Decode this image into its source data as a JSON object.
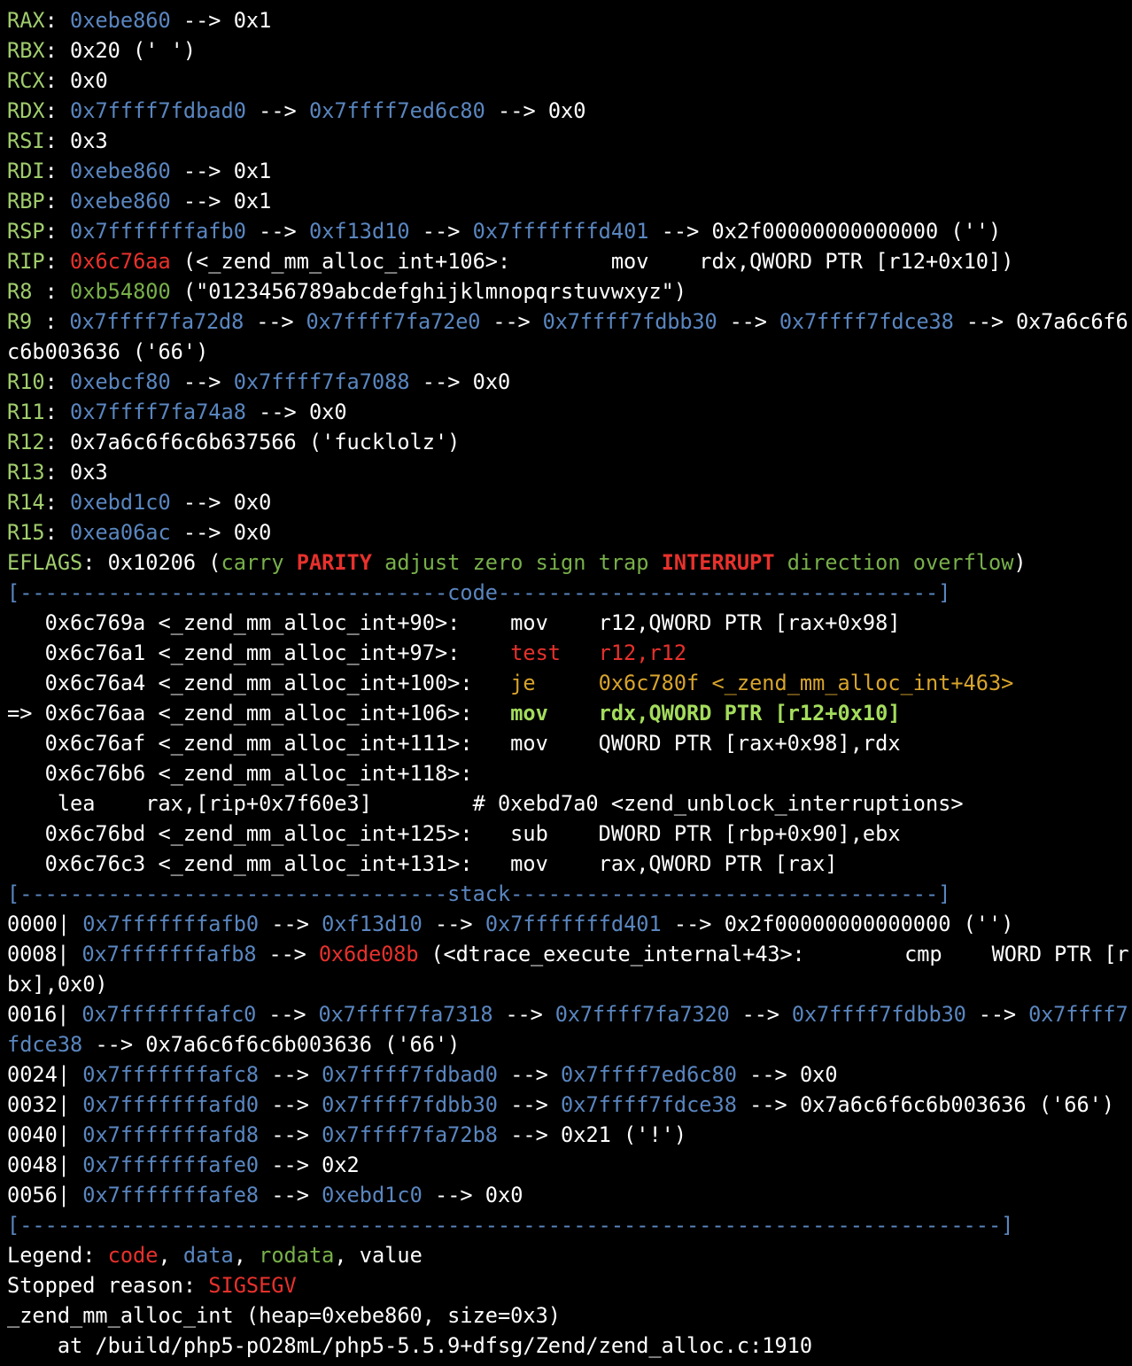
{
  "colors": {
    "value": "#ffffff",
    "code": "#e8312c",
    "data": "#5a86c0",
    "rodata": "#78b04a",
    "label": "#a0cc6c",
    "jump": "#d8a42c",
    "current": "#a4dc5c",
    "separator": "#5a86c0",
    "background": "#000000"
  },
  "terminal": {
    "lines": [
      [
        {
          "t": "RAX",
          "c": "label"
        },
        {
          "t": ": ",
          "c": "value"
        },
        {
          "t": "0xebe860",
          "c": "data"
        },
        {
          "t": " --> 0x1",
          "c": "value"
        }
      ],
      [
        {
          "t": "RBX",
          "c": "label"
        },
        {
          "t": ": 0x20 (' ')",
          "c": "value"
        }
      ],
      [
        {
          "t": "RCX",
          "c": "label"
        },
        {
          "t": ": 0x0",
          "c": "value"
        }
      ],
      [
        {
          "t": "RDX",
          "c": "label"
        },
        {
          "t": ": ",
          "c": "value"
        },
        {
          "t": "0x7ffff7fdbad0",
          "c": "data"
        },
        {
          "t": " --> ",
          "c": "value"
        },
        {
          "t": "0x7ffff7ed6c80",
          "c": "data"
        },
        {
          "t": " --> 0x0",
          "c": "value"
        }
      ],
      [
        {
          "t": "RSI",
          "c": "label"
        },
        {
          "t": ": 0x3",
          "c": "value"
        }
      ],
      [
        {
          "t": "RDI",
          "c": "label"
        },
        {
          "t": ": ",
          "c": "value"
        },
        {
          "t": "0xebe860",
          "c": "data"
        },
        {
          "t": " --> 0x1",
          "c": "value"
        }
      ],
      [
        {
          "t": "RBP",
          "c": "label"
        },
        {
          "t": ": ",
          "c": "value"
        },
        {
          "t": "0xebe860",
          "c": "data"
        },
        {
          "t": " --> 0x1",
          "c": "value"
        }
      ],
      [
        {
          "t": "RSP",
          "c": "label"
        },
        {
          "t": ": ",
          "c": "value"
        },
        {
          "t": "0x7fffffffafb0",
          "c": "data"
        },
        {
          "t": " --> ",
          "c": "value"
        },
        {
          "t": "0xf13d10",
          "c": "data"
        },
        {
          "t": " --> ",
          "c": "value"
        },
        {
          "t": "0x7fffffffd401",
          "c": "data"
        },
        {
          "t": " --> 0x2f00000000000000 ('')",
          "c": "value"
        }
      ],
      [
        {
          "t": "RIP",
          "c": "label"
        },
        {
          "t": ": ",
          "c": "value"
        },
        {
          "t": "0x6c76aa",
          "c": "code"
        },
        {
          "t": " (<_zend_mm_alloc_int+106>:        mov    rdx,QWORD PTR [r12+0x10])",
          "c": "value"
        }
      ],
      [
        {
          "t": "R8 ",
          "c": "label"
        },
        {
          "t": ": ",
          "c": "value"
        },
        {
          "t": "0xb54800",
          "c": "rodata"
        },
        {
          "t": " (\"0123456789abcdefghijklmnopqrstuvwxyz\")",
          "c": "value"
        }
      ],
      [
        {
          "t": "R9 ",
          "c": "label"
        },
        {
          "t": ": ",
          "c": "value"
        },
        {
          "t": "0x7ffff7fa72d8",
          "c": "data"
        },
        {
          "t": " --> ",
          "c": "value"
        },
        {
          "t": "0x7ffff7fa72e0",
          "c": "data"
        },
        {
          "t": " --> ",
          "c": "value"
        },
        {
          "t": "0x7ffff7fdbb30",
          "c": "data"
        },
        {
          "t": " --> ",
          "c": "value"
        },
        {
          "t": "0x7ffff7fdce38",
          "c": "data"
        },
        {
          "t": " --> 0x7a6c6f6",
          "c": "value"
        }
      ],
      [
        {
          "t": "c6b003636 ('66')",
          "c": "value"
        }
      ],
      [
        {
          "t": "R10",
          "c": "label"
        },
        {
          "t": ": ",
          "c": "value"
        },
        {
          "t": "0xebcf80",
          "c": "data"
        },
        {
          "t": " --> ",
          "c": "value"
        },
        {
          "t": "0x7ffff7fa7088",
          "c": "data"
        },
        {
          "t": " --> 0x0",
          "c": "value"
        }
      ],
      [
        {
          "t": "R11",
          "c": "label"
        },
        {
          "t": ": ",
          "c": "value"
        },
        {
          "t": "0x7ffff7fa74a8",
          "c": "data"
        },
        {
          "t": " --> 0x0",
          "c": "value"
        }
      ],
      [
        {
          "t": "R12",
          "c": "label"
        },
        {
          "t": ": 0x7a6c6f6c6b637566 ('fucklolz')",
          "c": "value"
        }
      ],
      [
        {
          "t": "R13",
          "c": "label"
        },
        {
          "t": ": 0x3",
          "c": "value"
        }
      ],
      [
        {
          "t": "R14",
          "c": "label"
        },
        {
          "t": ": ",
          "c": "value"
        },
        {
          "t": "0xebd1c0",
          "c": "data"
        },
        {
          "t": " --> 0x0",
          "c": "value"
        }
      ],
      [
        {
          "t": "R15",
          "c": "label"
        },
        {
          "t": ": ",
          "c": "value"
        },
        {
          "t": "0xea06ac",
          "c": "data"
        },
        {
          "t": " --> 0x0",
          "c": "value"
        }
      ],
      [
        {
          "t": "EFLAGS",
          "c": "label"
        },
        {
          "t": ": 0x10206 (",
          "c": "value"
        },
        {
          "t": "carry ",
          "c": "rodata"
        },
        {
          "t": "PARITY",
          "c": "code",
          "b": true
        },
        {
          "t": " adjust zero sign trap ",
          "c": "rodata"
        },
        {
          "t": "INTERRUPT",
          "c": "code",
          "b": true
        },
        {
          "t": " direction overflow",
          "c": "rodata"
        },
        {
          "t": ")",
          "c": "value"
        }
      ],
      [
        {
          "t": "[----------------------------------code-----------------------------------]",
          "c": "separator"
        }
      ],
      [
        {
          "t": "   0x6c769a <_zend_mm_alloc_int+90>:    mov    r12,QWORD PTR [rax+0x98]",
          "c": "value"
        }
      ],
      [
        {
          "t": "   0x6c76a1 <_zend_mm_alloc_int+97>:    ",
          "c": "value"
        },
        {
          "t": "test   r12,r12",
          "c": "code"
        }
      ],
      [
        {
          "t": "   0x6c76a4 <_zend_mm_alloc_int+100>:   ",
          "c": "value"
        },
        {
          "t": "je     0x6c780f <_zend_mm_alloc_int+463>",
          "c": "jump"
        }
      ],
      [
        {
          "t": "=> 0x6c76aa <_zend_mm_alloc_int+106>:   ",
          "c": "value"
        },
        {
          "t": "mov    rdx,QWORD PTR [r12+0x10]",
          "c": "current",
          "b": true
        }
      ],
      [
        {
          "t": "   0x6c76af <_zend_mm_alloc_int+111>:   mov    QWORD PTR [rax+0x98],rdx",
          "c": "value"
        }
      ],
      [
        {
          "t": "   0x6c76b6 <_zend_mm_alloc_int+118>:",
          "c": "value"
        }
      ],
      [
        {
          "t": "    lea    rax,[rip+0x7f60e3]        # 0xebd7a0 <zend_unblock_interruptions>",
          "c": "value"
        }
      ],
      [
        {
          "t": "   0x6c76bd <_zend_mm_alloc_int+125>:   sub    DWORD PTR [rbp+0x90],ebx",
          "c": "value"
        }
      ],
      [
        {
          "t": "   0x6c76c3 <_zend_mm_alloc_int+131>:   mov    rax,QWORD PTR [rax]",
          "c": "value"
        }
      ],
      [
        {
          "t": "[----------------------------------stack----------------------------------]",
          "c": "separator"
        }
      ],
      [
        {
          "t": "0000| ",
          "c": "value"
        },
        {
          "t": "0x7fffffffafb0",
          "c": "data"
        },
        {
          "t": " --> ",
          "c": "value"
        },
        {
          "t": "0xf13d10",
          "c": "data"
        },
        {
          "t": " --> ",
          "c": "value"
        },
        {
          "t": "0x7fffffffd401",
          "c": "data"
        },
        {
          "t": " --> 0x2f00000000000000 ('')",
          "c": "value"
        }
      ],
      [
        {
          "t": "0008| ",
          "c": "value"
        },
        {
          "t": "0x7fffffffafb8",
          "c": "data"
        },
        {
          "t": " --> ",
          "c": "value"
        },
        {
          "t": "0x6de08b",
          "c": "code"
        },
        {
          "t": " (<dtrace_execute_internal+43>:        cmp    WORD PTR [r",
          "c": "value"
        }
      ],
      [
        {
          "t": "bx],0x0)",
          "c": "value"
        }
      ],
      [
        {
          "t": "0016| ",
          "c": "value"
        },
        {
          "t": "0x7fffffffafc0",
          "c": "data"
        },
        {
          "t": " --> ",
          "c": "value"
        },
        {
          "t": "0x7ffff7fa7318",
          "c": "data"
        },
        {
          "t": " --> ",
          "c": "value"
        },
        {
          "t": "0x7ffff7fa7320",
          "c": "data"
        },
        {
          "t": " --> ",
          "c": "value"
        },
        {
          "t": "0x7ffff7fdbb30",
          "c": "data"
        },
        {
          "t": " --> ",
          "c": "value"
        },
        {
          "t": "0x7ffff7",
          "c": "data"
        }
      ],
      [
        {
          "t": "fdce38",
          "c": "data"
        },
        {
          "t": " --> 0x7a6c6f6c6b003636 ('66')",
          "c": "value"
        }
      ],
      [
        {
          "t": "0024| ",
          "c": "value"
        },
        {
          "t": "0x7fffffffafc8",
          "c": "data"
        },
        {
          "t": " --> ",
          "c": "value"
        },
        {
          "t": "0x7ffff7fdbad0",
          "c": "data"
        },
        {
          "t": " --> ",
          "c": "value"
        },
        {
          "t": "0x7ffff7ed6c80",
          "c": "data"
        },
        {
          "t": " --> 0x0",
          "c": "value"
        }
      ],
      [
        {
          "t": "0032| ",
          "c": "value"
        },
        {
          "t": "0x7fffffffafd0",
          "c": "data"
        },
        {
          "t": " --> ",
          "c": "value"
        },
        {
          "t": "0x7ffff7fdbb30",
          "c": "data"
        },
        {
          "t": " --> ",
          "c": "value"
        },
        {
          "t": "0x7ffff7fdce38",
          "c": "data"
        },
        {
          "t": " --> 0x7a6c6f6c6b003636 ('66')",
          "c": "value"
        }
      ],
      [
        {
          "t": "0040| ",
          "c": "value"
        },
        {
          "t": "0x7fffffffafd8",
          "c": "data"
        },
        {
          "t": " --> ",
          "c": "value"
        },
        {
          "t": "0x7ffff7fa72b8",
          "c": "data"
        },
        {
          "t": " --> 0x21 ('!')",
          "c": "value"
        }
      ],
      [
        {
          "t": "0048| ",
          "c": "value"
        },
        {
          "t": "0x7fffffffafe0",
          "c": "data"
        },
        {
          "t": " --> 0x2",
          "c": "value"
        }
      ],
      [
        {
          "t": "0056| ",
          "c": "value"
        },
        {
          "t": "0x7fffffffafe8",
          "c": "data"
        },
        {
          "t": " --> ",
          "c": "value"
        },
        {
          "t": "0xebd1c0",
          "c": "data"
        },
        {
          "t": " --> 0x0",
          "c": "value"
        }
      ],
      [
        {
          "t": "[------------------------------------------------------------------------------]",
          "c": "separator"
        }
      ],
      [
        {
          "t": "Legend: ",
          "c": "value"
        },
        {
          "t": "code",
          "c": "code"
        },
        {
          "t": ", ",
          "c": "value"
        },
        {
          "t": "data",
          "c": "data"
        },
        {
          "t": ", ",
          "c": "value"
        },
        {
          "t": "rodata",
          "c": "rodata"
        },
        {
          "t": ", value",
          "c": "value"
        }
      ],
      [
        {
          "t": "Stopped reason: ",
          "c": "value"
        },
        {
          "t": "SIGSEGV",
          "c": "code"
        }
      ],
      [
        {
          "t": "_zend_mm_alloc_int (heap=0xebe860, size=0x3)",
          "c": "value"
        }
      ],
      [
        {
          "t": "    at /build/php5-pO28mL/php5-5.5.9+dfsg/Zend/zend_alloc.c:1910",
          "c": "value"
        }
      ]
    ]
  }
}
